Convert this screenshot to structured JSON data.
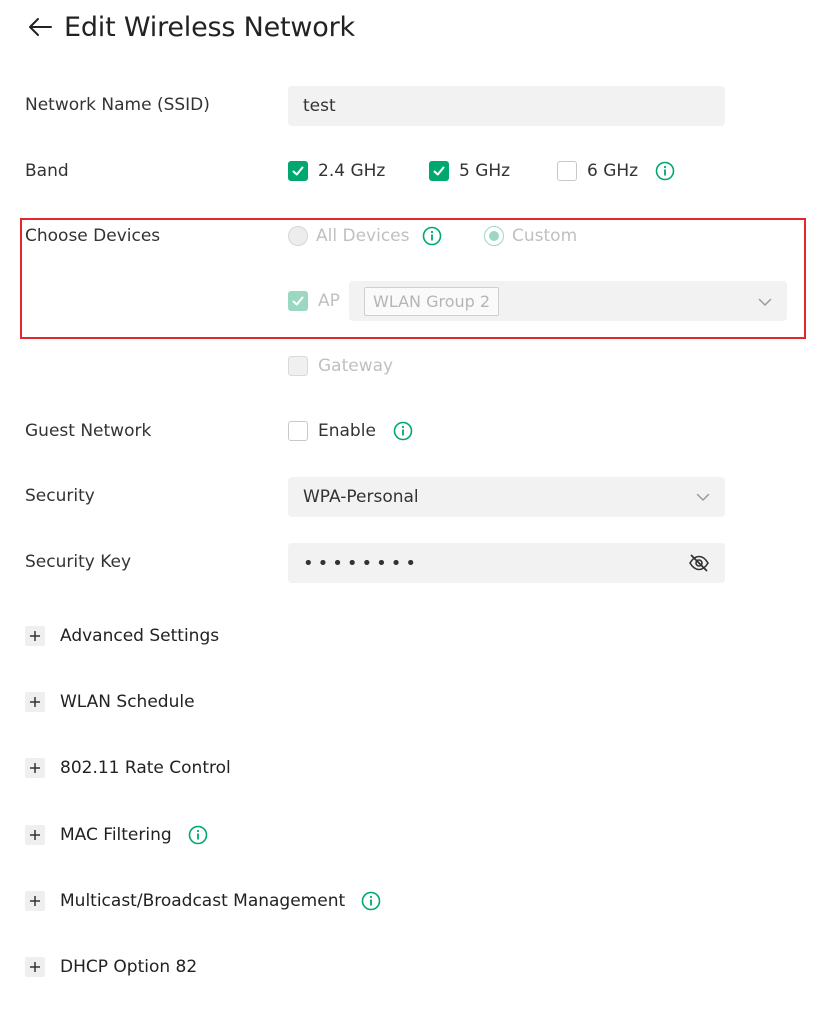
{
  "header": {
    "title": "Edit Wireless Network"
  },
  "ssid": {
    "label": "Network Name (SSID)",
    "value": "test"
  },
  "band": {
    "label": "Band",
    "options": [
      {
        "label": "2.4 GHz",
        "checked": true
      },
      {
        "label": "5 GHz",
        "checked": true
      },
      {
        "label": "6 GHz",
        "checked": false
      }
    ]
  },
  "devices": {
    "label": "Choose Devices",
    "all_devices": "All Devices",
    "custom": "Custom",
    "ap_label": "AP",
    "ap_group": "WLAN Group 2",
    "gateway_label": "Gateway"
  },
  "guest": {
    "label": "Guest Network",
    "option": "Enable"
  },
  "security": {
    "label": "Security",
    "value": "WPA-Personal"
  },
  "security_key": {
    "label": "Security Key",
    "value": "••••••••"
  },
  "sections": [
    {
      "label": "Advanced Settings",
      "info": false
    },
    {
      "label": "WLAN Schedule",
      "info": false
    },
    {
      "label": "802.11 Rate Control",
      "info": false
    },
    {
      "label": "MAC Filtering",
      "info": true
    },
    {
      "label": "Multicast/Broadcast Management",
      "info": true
    },
    {
      "label": "DHCP Option 82",
      "info": false
    }
  ],
  "colors": {
    "accent": "#00a870",
    "accent_disabled": "#9bd8c2",
    "highlight": "#e0282e"
  }
}
